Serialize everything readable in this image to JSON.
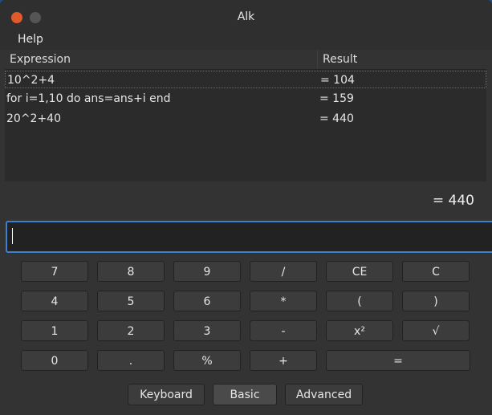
{
  "window": {
    "title": "Alk"
  },
  "menu": {
    "help": "Help"
  },
  "history": {
    "headers": {
      "expression": "Expression",
      "result": "Result"
    },
    "rows": [
      {
        "expression": "10^2+4",
        "result": "= 104"
      },
      {
        "expression": "for i=1,10 do ans=ans+i end",
        "result": "= 159"
      },
      {
        "expression": "20^2+40",
        "result": "= 440"
      }
    ]
  },
  "current_result": "= 440",
  "input": {
    "value": ""
  },
  "keypad": {
    "row1": [
      "7",
      "8",
      "9",
      "/",
      "CE",
      "C"
    ],
    "row2": [
      "4",
      "5",
      "6",
      "*",
      "(",
      ")"
    ],
    "row3": [
      "1",
      "2",
      "3",
      "-",
      "x²",
      "√"
    ],
    "row4": [
      "0",
      ".",
      "%",
      "+",
      "="
    ]
  },
  "modes": {
    "keyboard": "Keyboard",
    "basic": "Basic",
    "advanced": "Advanced",
    "selected": "Basic"
  },
  "colors": {
    "accent": "#3e7fd2",
    "close": "#e0592a",
    "background": "#333333"
  }
}
